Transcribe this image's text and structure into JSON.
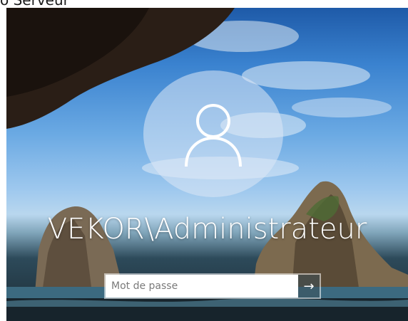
{
  "header": {
    "title": "o Serveur"
  },
  "login": {
    "username": "VEKOR\\Administrateur",
    "password_placeholder": "Mot de passe",
    "submit_glyph": "→",
    "submit_icon": "arrow-right-icon",
    "avatar_icon": "user-silhouette-icon"
  },
  "colors": {
    "sky_top": "#1e5aa8",
    "sky_mid": "#6aa9e3",
    "cliff": "#2a1e16",
    "text": "#ffffff"
  }
}
